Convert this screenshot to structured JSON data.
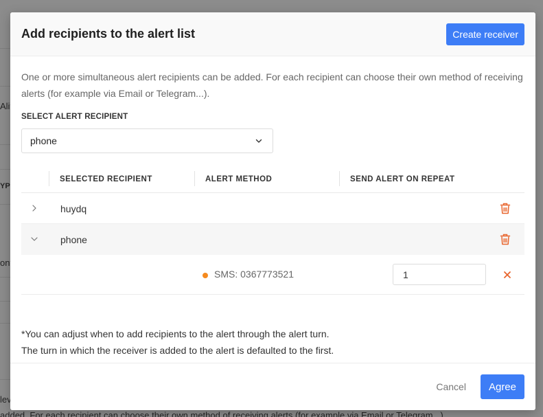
{
  "background": {
    "fragments": [
      "Aliv",
      "YPE",
      "onf",
      "lev"
    ],
    "bottom_text": "added. For each recipient can choose their own method of receiving alerts (for example via Email or Telegram...)."
  },
  "modal": {
    "title": "Add recipients to the alert list",
    "create_receiver_label": "Create receiver",
    "description": "One or more simultaneous alert recipients can be added. For each recipient can choose their own method of receiving alerts (for example via Email or Telegram...).",
    "select_label": "SELECT ALERT RECIPIENT",
    "select_value": "phone",
    "table": {
      "columns": [
        "SELECTED RECIPIENT",
        "ALERT METHOD",
        "SEND ALERT ON REPEAT"
      ],
      "rows": [
        {
          "name": "huydq",
          "expanded": false
        },
        {
          "name": "phone",
          "expanded": true,
          "methods": [
            {
              "label": "SMS: 0367773521",
              "repeat": "1",
              "status_color": "#f58a1f"
            }
          ]
        }
      ]
    },
    "note_line1": "*You can adjust when to add recipients to the alert through the alert turn.",
    "note_line2": "The turn in which the receiver is added to the alert is defaulted to the first.",
    "cancel_label": "Cancel",
    "agree_label": "Agree"
  },
  "colors": {
    "primary": "#3d7df6",
    "danger": "#e8642c",
    "status_dot": "#f58a1f"
  },
  "icons": {
    "select_arrow": "chevron-down-icon",
    "collapsed": "chevron-right-icon",
    "expanded": "chevron-down-icon",
    "delete": "trash-icon",
    "remove": "close-icon"
  }
}
